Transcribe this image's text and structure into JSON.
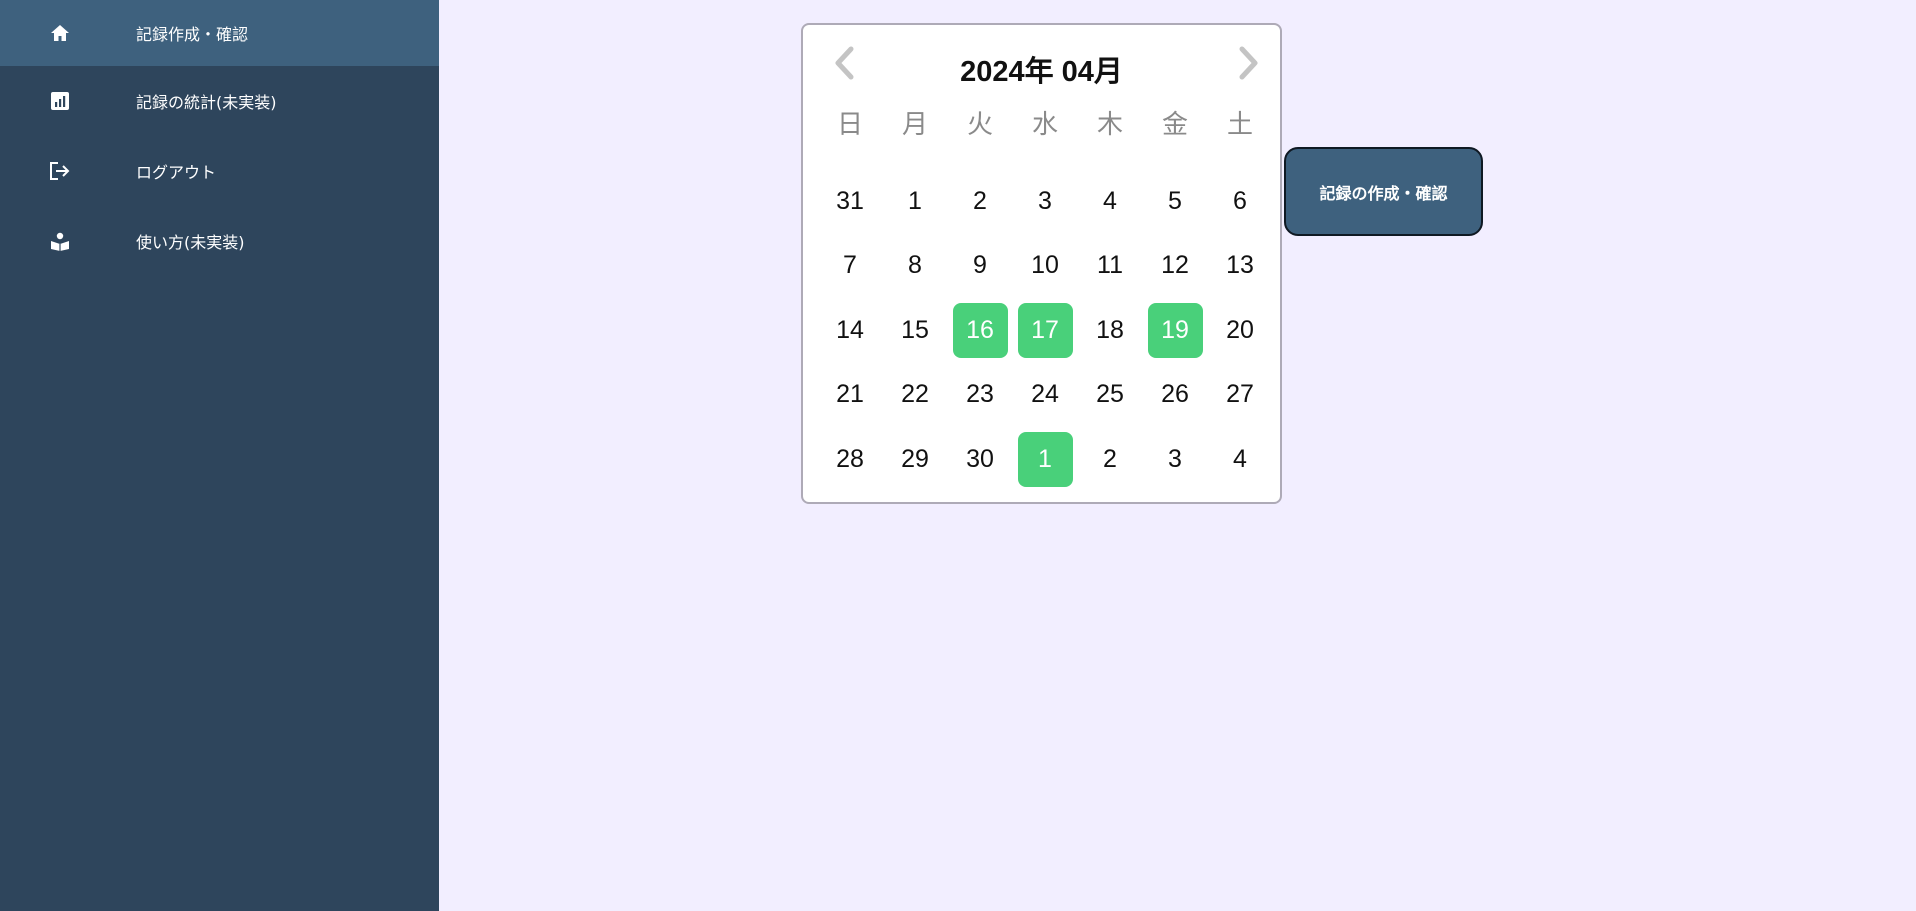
{
  "sidebar": {
    "items": [
      {
        "label": "記録作成・確認",
        "icon": "home-icon",
        "active": true
      },
      {
        "label": "記録の統計(未実装)",
        "icon": "chart-icon",
        "active": false
      },
      {
        "label": "ログアウト",
        "icon": "logout-icon",
        "active": false
      },
      {
        "label": "使い方(未実装)",
        "icon": "reader-icon",
        "active": false
      }
    ]
  },
  "calendar": {
    "title": "2024年 04月",
    "prev_icon": "chevron-left-icon",
    "next_icon": "chevron-right-icon",
    "weekdays": [
      "日",
      "月",
      "火",
      "水",
      "木",
      "金",
      "土"
    ],
    "weeks": [
      [
        {
          "d": "31",
          "m": false
        },
        {
          "d": "1",
          "m": false
        },
        {
          "d": "2",
          "m": false
        },
        {
          "d": "3",
          "m": false
        },
        {
          "d": "4",
          "m": false
        },
        {
          "d": "5",
          "m": false
        },
        {
          "d": "6",
          "m": false
        }
      ],
      [
        {
          "d": "7",
          "m": false
        },
        {
          "d": "8",
          "m": false
        },
        {
          "d": "9",
          "m": false
        },
        {
          "d": "10",
          "m": false
        },
        {
          "d": "11",
          "m": false
        },
        {
          "d": "12",
          "m": false
        },
        {
          "d": "13",
          "m": false
        }
      ],
      [
        {
          "d": "14",
          "m": false
        },
        {
          "d": "15",
          "m": false
        },
        {
          "d": "16",
          "m": true
        },
        {
          "d": "17",
          "m": true
        },
        {
          "d": "18",
          "m": false
        },
        {
          "d": "19",
          "m": true
        },
        {
          "d": "20",
          "m": false
        }
      ],
      [
        {
          "d": "21",
          "m": false
        },
        {
          "d": "22",
          "m": false
        },
        {
          "d": "23",
          "m": false
        },
        {
          "d": "24",
          "m": false
        },
        {
          "d": "25",
          "m": false
        },
        {
          "d": "26",
          "m": false
        },
        {
          "d": "27",
          "m": false
        }
      ],
      [
        {
          "d": "28",
          "m": false
        },
        {
          "d": "29",
          "m": false
        },
        {
          "d": "30",
          "m": false
        },
        {
          "d": "1",
          "m": true
        },
        {
          "d": "2",
          "m": false
        },
        {
          "d": "3",
          "m": false
        },
        {
          "d": "4",
          "m": false
        }
      ]
    ]
  },
  "action": {
    "label": "記録の作成・確認"
  },
  "colors": {
    "sidebar": "#2e455c",
    "sidebar_active": "#3e617e",
    "background": "#f2eeff",
    "marked_day": "#49d07a",
    "button": "#3e617e"
  }
}
